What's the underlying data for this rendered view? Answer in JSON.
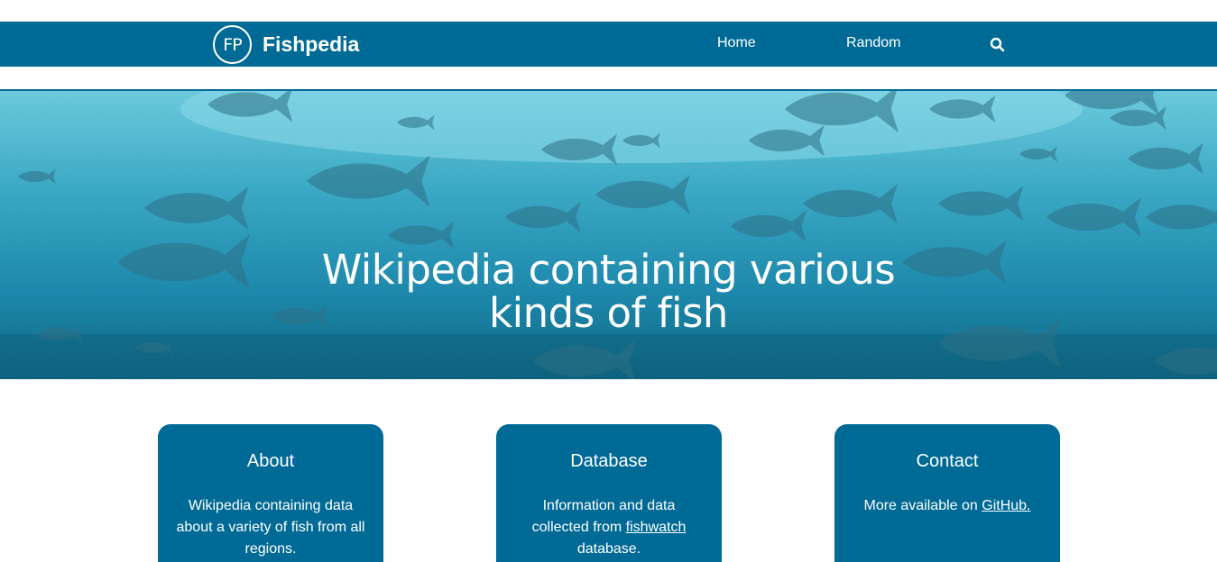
{
  "header": {
    "logo_text": "FP",
    "brand": "Fishpedia",
    "nav": {
      "home": "Home",
      "random": "Random"
    },
    "search_icon": "search-icon"
  },
  "hero": {
    "title_line1": "Wikipedia containing various",
    "title_line2": "kinds of fish"
  },
  "cards": {
    "about": {
      "title": "About",
      "text": "Wikipedia containing data about a variety of fish from all regions."
    },
    "database": {
      "title": "Database",
      "text_before": "Information and data collected from ",
      "link": "fishwatch",
      "text_after": " database."
    },
    "contact": {
      "title": "Contact",
      "text_before": "More available on ",
      "link": "GitHub."
    }
  },
  "colors": {
    "primary": "#006a96",
    "hero_light": "#6cc9dc",
    "hero_dark": "#0f6785"
  }
}
